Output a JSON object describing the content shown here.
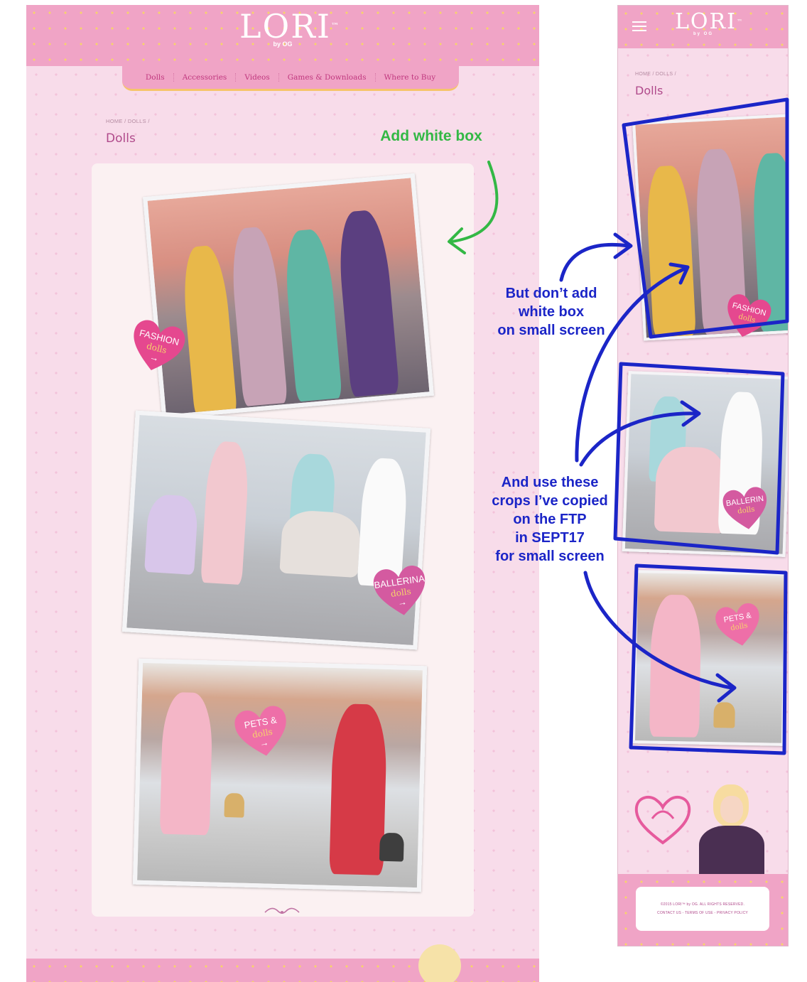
{
  "brand": {
    "logo": "LORI",
    "tm": "™",
    "sub": "by OG"
  },
  "nav": [
    "Dolls",
    "Accessories",
    "Videos",
    "Games & Downloads",
    "Where to Buy"
  ],
  "breadcrumb": "HOME / DOLLS /",
  "page_title": "Dolls",
  "categories": [
    {
      "line1": "FASHION",
      "line2": "dolls"
    },
    {
      "line1": "BALLERINA",
      "line2": "dolls"
    },
    {
      "line1": "PETS &",
      "line2": "dolls"
    }
  ],
  "arrow_glyph": "→",
  "mobile_categories": [
    {
      "line1": "FASHION",
      "line2": "dolls"
    },
    {
      "line1": "BALLERIN",
      "line2": "dolls"
    },
    {
      "line1": "PETS &",
      "line2": "dolls"
    }
  ],
  "footer": {
    "copyright": "©2015 LORI™ by OG. ALL RIGHTS RESERVED.",
    "links": "CONTACT US - TERMS OF USE - PRIVACY POLICY"
  },
  "annotations": {
    "green": "Add white box",
    "blue1": [
      "But don’t add",
      "white box",
      "on small screen"
    ],
    "blue2": [
      "And use these",
      "crops I’ve copied",
      "on the FTP",
      "in SEPT17",
      "for small screen"
    ]
  },
  "colors": {
    "pink": "#f0a4c6",
    "annotation_green": "#33b845",
    "annotation_blue": "#1b25c7",
    "title": "#b04a8b"
  }
}
